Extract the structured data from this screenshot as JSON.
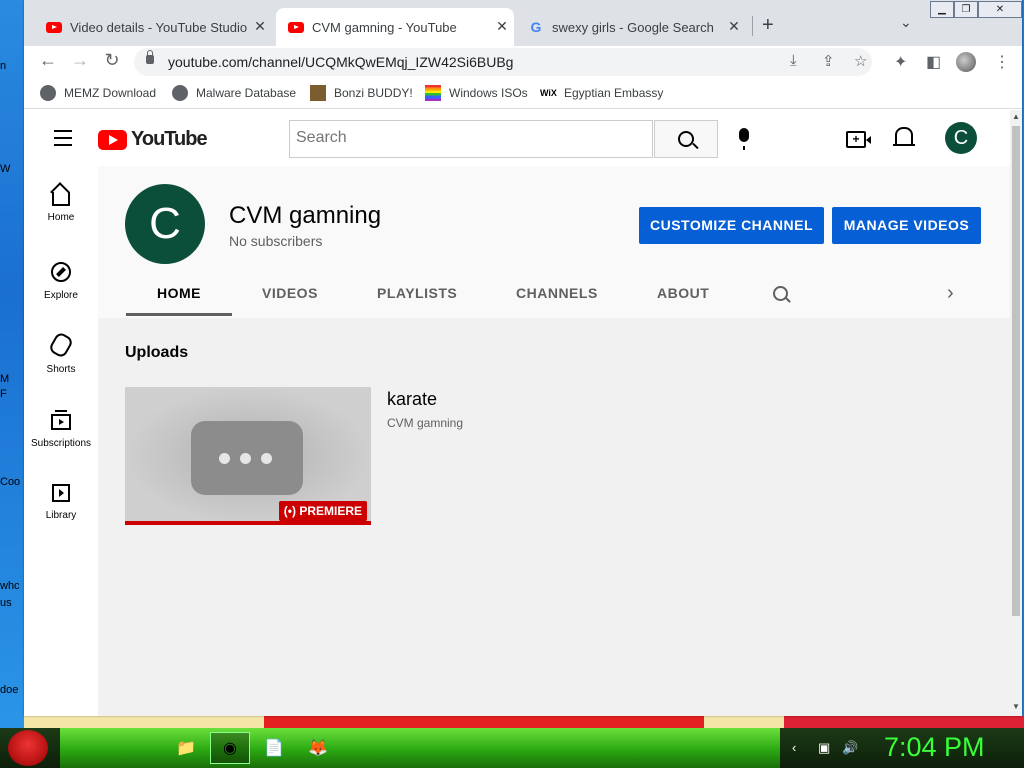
{
  "browser": {
    "tabs": [
      {
        "title": "Video details - YouTube Studio",
        "favicon": "youtube-icon",
        "active": false
      },
      {
        "title": "CVM gamning - YouTube",
        "favicon": "youtube-icon",
        "active": true
      },
      {
        "title": "swexy girls - Google Search",
        "favicon": "google-icon",
        "active": false
      }
    ],
    "url": "youtube.com/channel/UCQMkQwEMqj_IZW42Si6BUBg",
    "bookmarks": [
      {
        "label": "MEMZ Download",
        "icon": "globe-icon"
      },
      {
        "label": "Malware Database",
        "icon": "globe-icon"
      },
      {
        "label": "Bonzi BUDDY!",
        "icon": "bonzi-icon"
      },
      {
        "label": "Windows ISOs",
        "icon": "rainbow-flag-icon"
      },
      {
        "label": "Egyptian Embassy",
        "icon": "wix-icon"
      }
    ]
  },
  "youtube": {
    "logo_text": "YouTube",
    "search_placeholder": "Search",
    "account_initial": "C",
    "guide": [
      {
        "label": "Home",
        "icon": "home-icon"
      },
      {
        "label": "Explore",
        "icon": "compass-icon"
      },
      {
        "label": "Shorts",
        "icon": "shorts-icon"
      },
      {
        "label": "Subscriptions",
        "icon": "subscriptions-icon"
      },
      {
        "label": "Library",
        "icon": "library-icon"
      }
    ],
    "channel": {
      "avatar_initial": "C",
      "name": "CVM gamning",
      "subscribers": "No subscribers",
      "customize_label": "CUSTOMIZE CHANNEL",
      "manage_label": "MANAGE VIDEOS"
    },
    "tabs": [
      "HOME",
      "VIDEOS",
      "PLAYLISTS",
      "CHANNELS",
      "ABOUT"
    ],
    "active_tab": "HOME",
    "shelf": {
      "title": "Uploads",
      "video": {
        "title": "karate",
        "channel": "CVM gamning",
        "badge": "PREMIERE"
      }
    }
  },
  "desktop": {
    "icon_labels": [
      "n",
      "W",
      "M",
      "F",
      "Coo",
      "whc",
      "us",
      "doe"
    ]
  },
  "taskbar": {
    "clock": "7:04 PM"
  },
  "colors": {
    "accent_blue": "#065fd4",
    "youtube_red": "#ff0000",
    "avatar_green": "#0b4f3b",
    "clock_green": "#39ff39"
  }
}
